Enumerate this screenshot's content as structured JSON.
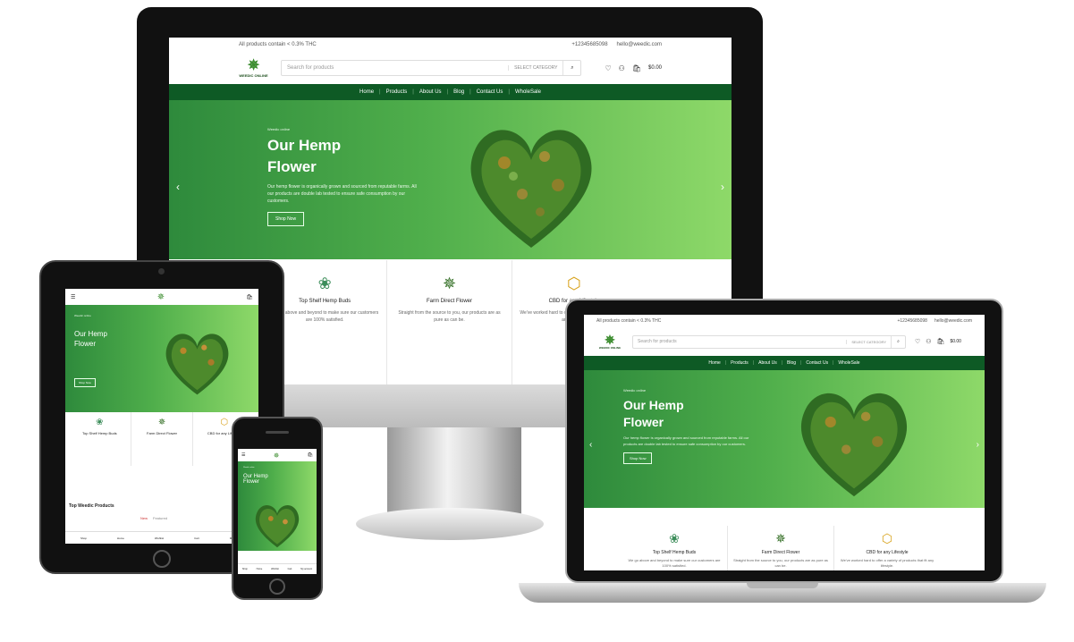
{
  "colors": {
    "brand_green": "#0e5a25",
    "hero_start": "#2e8a3c",
    "hero_end": "#8ed969"
  },
  "site": {
    "topbar_text": "All products contain < 0.3% THC",
    "phone": "+12345685098",
    "email": "hello@weedic.com",
    "logo_text": "WEEDIC ONLINE",
    "search_placeholder": "Search for products",
    "select_category": "SELECT CATEGORY",
    "cart_total": "$0.00",
    "nav": [
      "Home",
      "Products",
      "About Us",
      "Blog",
      "Contact Us",
      "WholeSale"
    ],
    "hero": {
      "kicker": "Weedic online",
      "title_line1": "Our Hemp",
      "title_line2": "Flower",
      "desc": "Our hemp flower is organically grown and sourced from reputable farms. All our products are double lab tested to ensure safe consumption by our customers.",
      "button": "Shop Now"
    },
    "features": [
      {
        "icon": "bud-mascot-icon",
        "title": "Top Shelf Hemp Buds",
        "desc": "We go above and beyond to make sure our customers are 100% satisfied."
      },
      {
        "icon": "hemp-leaf-icon",
        "title": "Farm Direct Flower",
        "desc": "Straight from the source to you, our products are as pure as can be."
      },
      {
        "icon": "cbd-molecule-icon",
        "title": "CBD for any Lifestyle",
        "desc": "We've worked hard to offer a variety of products that fit any lifestyle."
      }
    ],
    "section_title": "Top Weedic Products",
    "tabs": [
      "New",
      "Featured"
    ],
    "mobile_nav": [
      "Shop",
      "Home",
      "Wishlist",
      "Cart",
      "My account"
    ]
  }
}
